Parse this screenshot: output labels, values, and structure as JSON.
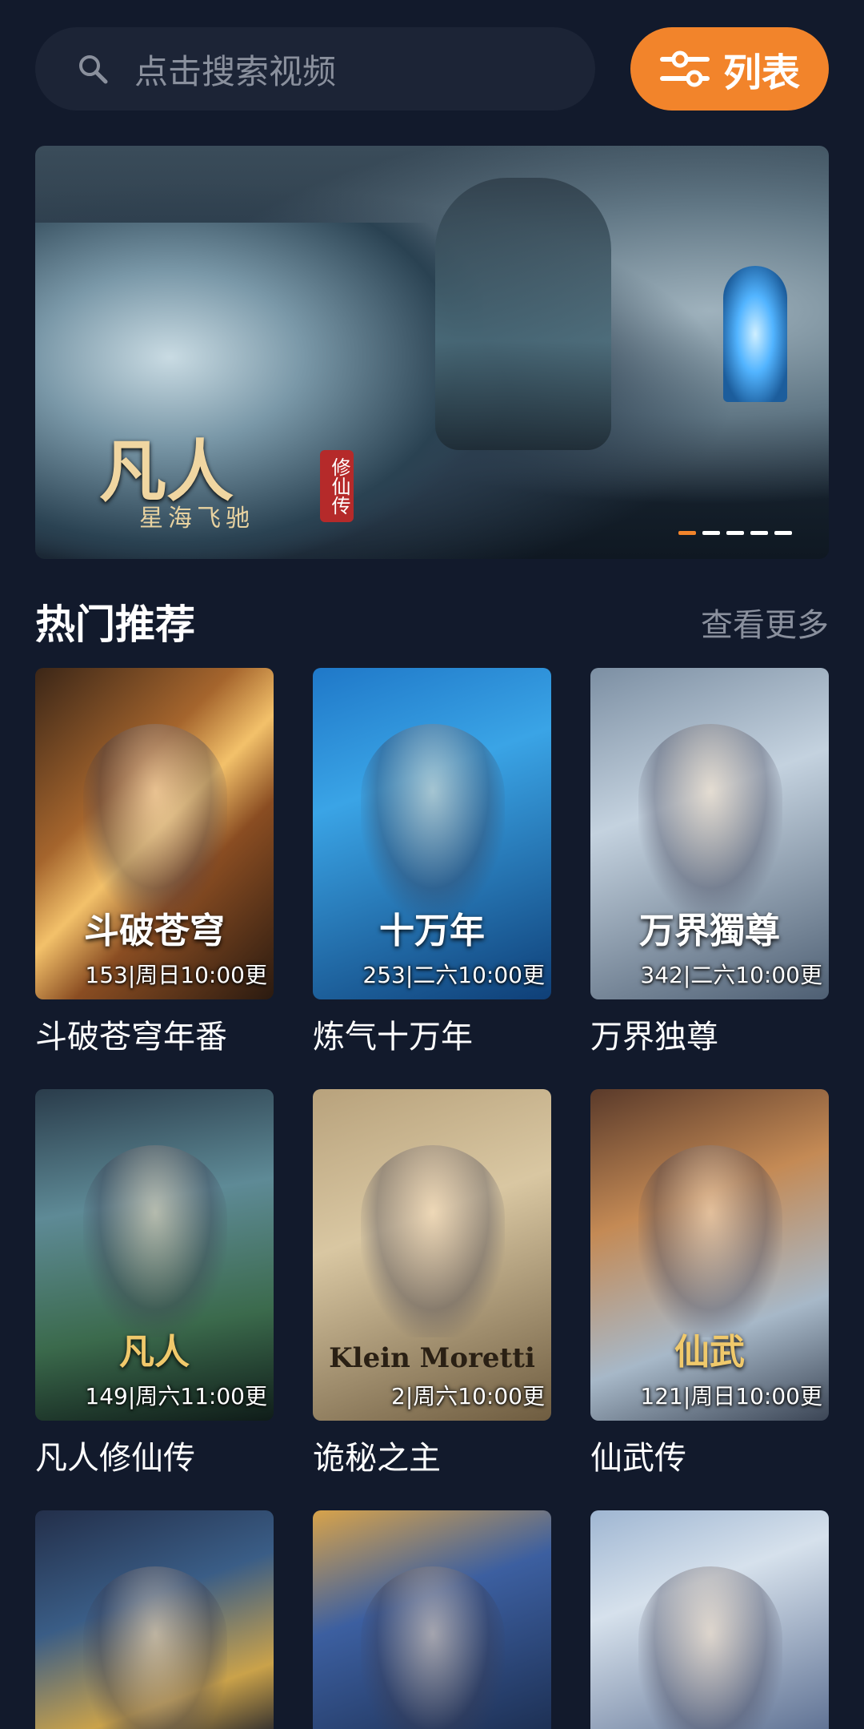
{
  "search": {
    "placeholder": "点击搜索视频",
    "icon": "search-icon"
  },
  "list_button": {
    "label": "列表",
    "icon": "filter-sliders-icon"
  },
  "banner": {
    "title": "凡人",
    "subtitle": "星海飞驰",
    "seal": "修仙传",
    "dots": 5,
    "active_dot": 0
  },
  "section": {
    "title": "热门推荐",
    "more": "查看更多"
  },
  "cards": [
    {
      "name": "斗破苍穹年番",
      "badge": "153|周日10:00更",
      "logo": "斗破苍穹"
    },
    {
      "name": "炼气十万年",
      "badge": "253|二六10:00更",
      "logo": "十万年"
    },
    {
      "name": "万界独尊",
      "badge": "342|二六10:00更",
      "logo": "万界獨尊"
    },
    {
      "name": "凡人修仙传",
      "badge": "149|周六11:00更",
      "logo": "凡人"
    },
    {
      "name": "诡秘之主",
      "badge": "2|周六10:00更",
      "logo": "Klein Moretti"
    },
    {
      "name": "仙武传",
      "badge": "121|周日10:00更",
      "logo": "仙武"
    }
  ],
  "colors": {
    "background": "#121a2c",
    "accent": "#f2842b",
    "search_bg": "#1c2436",
    "muted_text": "#8a909d"
  }
}
